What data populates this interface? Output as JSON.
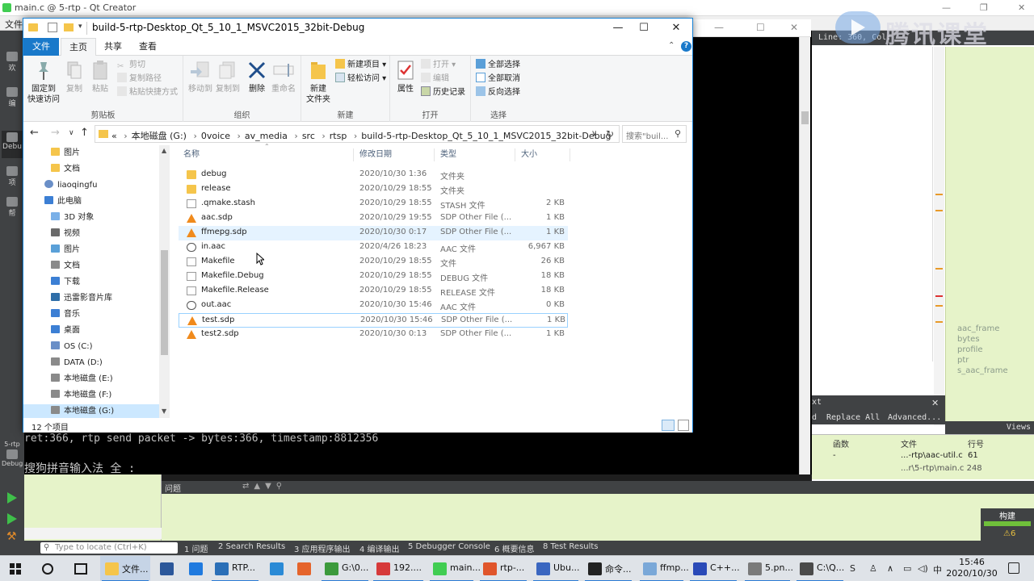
{
  "qt": {
    "title": "main.c @ 5-rtp - Qt Creator",
    "menu_file": "文件",
    "modes": [
      "欢",
      "编",
      "Debu",
      "项",
      "帮"
    ],
    "mode_run_label": "5-rtp",
    "mode_debug_label": "Debug",
    "locator_bar": "Line: 360, Col:",
    "console_line1": "ret:366, rtp send packet -> bytes:366, timestamp:8812356",
    "console_line2": "搜狗拼音输入法 全 :",
    "outline_items": [
      "aac_frame",
      "bytes",
      "profile",
      "ptr",
      "s_aac_frame"
    ],
    "find_partial": "xt",
    "find_d": "d",
    "replace_all": "Replace All",
    "advanced": "Advanced...",
    "views": "Views",
    "callstack_headers": {
      "func": "函数",
      "file": "文件",
      "line": "行号"
    },
    "callstack_row": {
      "func": "-",
      "file": "...-rtp\\aac-util.c",
      "line": "61"
    },
    "callstack_row2": "...r\\5-rtp\\main.c  248",
    "issues_header": "问题",
    "build_label": "构建",
    "warn_count": "⚠6",
    "locate_placeholder": "Type to locate (Ctrl+K)",
    "status_tabs": [
      "1 问题",
      "2 Search Results",
      "3 应用程序输出",
      "4 编译输出",
      "5 Debugger Console",
      "6 概要信息",
      "8 Test Results"
    ],
    "watermark": "腾讯课堂"
  },
  "explorer": {
    "title": "build-5-rtp-Desktop_Qt_5_10_1_MSVC2015_32bit-Debug",
    "tabs": {
      "file": "文件",
      "home": "主页",
      "share": "共享",
      "view": "查看"
    },
    "ribbon": {
      "clipboard": {
        "label": "剪贴板",
        "pin": "固定到",
        "pin2": "快速访问",
        "copy": "复制",
        "paste": "粘贴",
        "cut": "剪切",
        "copy_path": "复制路径",
        "paste_shortcut": "粘贴快捷方式"
      },
      "organize": {
        "label": "组织",
        "move_to": "移动到",
        "copy_to": "复制到",
        "delete": "删除",
        "rename": "重命名"
      },
      "new": {
        "label": "新建",
        "new_folder": "新建",
        "new_folder2": "文件夹",
        "new_item": "新建项目 ▾",
        "easy_access": "轻松访问 ▾"
      },
      "open": {
        "label": "打开",
        "properties": "属性",
        "open": "打开 ▾",
        "edit": "编辑",
        "history": "历史记录"
      },
      "select": {
        "label": "选择",
        "select_all": "全部选择",
        "select_none": "全部取消",
        "invert": "反向选择"
      }
    },
    "address": {
      "crumbs": [
        "本地磁盘 (G:)",
        "0voice",
        "av_media",
        "src",
        "rtsp",
        "build-5-rtp-Desktop_Qt_5_10_1_MSVC2015_32bit-Debug"
      ],
      "prefix": "«",
      "search_placeholder": "搜索\"buil..."
    },
    "nav": [
      {
        "label": "图片",
        "color": "#f5c54b"
      },
      {
        "label": "文档",
        "color": "#f5c54b"
      },
      {
        "label": "liaoqingfu",
        "color": "#6a8fc7"
      },
      {
        "label": "此电脑",
        "color": "#3c7fd4"
      },
      {
        "label": "3D 对象",
        "color": "#7ab0e8"
      },
      {
        "label": "视频",
        "color": "#6a6a6a"
      },
      {
        "label": "图片",
        "color": "#5aa0d8"
      },
      {
        "label": "文档",
        "color": "#8a8a8a"
      },
      {
        "label": "下载",
        "color": "#3c7fd4"
      },
      {
        "label": "迅雷影音片库",
        "color": "#2f6ea8"
      },
      {
        "label": "音乐",
        "color": "#3c7fd4"
      },
      {
        "label": "桌面",
        "color": "#3c7fd4"
      },
      {
        "label": "OS (C:)",
        "color": "#6a8fc7"
      },
      {
        "label": "DATA (D:)",
        "color": "#8a8a8a"
      },
      {
        "label": "本地磁盘 (E:)",
        "color": "#8a8a8a"
      },
      {
        "label": "本地磁盘 (F:)",
        "color": "#8a8a8a"
      },
      {
        "label": "本地磁盘 (G:)",
        "color": "#8a8a8a"
      }
    ],
    "columns": {
      "name": "名称",
      "modified": "修改日期",
      "type": "类型",
      "size": "大小"
    },
    "files": [
      {
        "name": "debug",
        "date": "2020/10/30 1:36",
        "type": "文件夹",
        "size": "",
        "icon": "folder"
      },
      {
        "name": "release",
        "date": "2020/10/29 18:55",
        "type": "文件夹",
        "size": "",
        "icon": "folder"
      },
      {
        "name": ".qmake.stash",
        "date": "2020/10/29 18:55",
        "type": "STASH 文件",
        "size": "2 KB",
        "icon": "doc"
      },
      {
        "name": "aac.sdp",
        "date": "2020/10/29 19:55",
        "type": "SDP Other File (...",
        "size": "1 KB",
        "icon": "vlc"
      },
      {
        "name": "ffmepg.sdp",
        "date": "2020/10/30 0:17",
        "type": "SDP Other File (...",
        "size": "1 KB",
        "icon": "vlc"
      },
      {
        "name": "in.aac",
        "date": "2020/4/26 18:23",
        "type": "AAC 文件",
        "size": "6,967 KB",
        "icon": "media"
      },
      {
        "name": "Makefile",
        "date": "2020/10/29 18:55",
        "type": "文件",
        "size": "26 KB",
        "icon": "doc"
      },
      {
        "name": "Makefile.Debug",
        "date": "2020/10/29 18:55",
        "type": "DEBUG 文件",
        "size": "18 KB",
        "icon": "doc"
      },
      {
        "name": "Makefile.Release",
        "date": "2020/10/29 18:55",
        "type": "RELEASE 文件",
        "size": "18 KB",
        "icon": "doc"
      },
      {
        "name": "out.aac",
        "date": "2020/10/30 15:46",
        "type": "AAC 文件",
        "size": "0 KB",
        "icon": "media"
      },
      {
        "name": "test.sdp",
        "date": "2020/10/30 15:46",
        "type": "SDP Other File (...",
        "size": "1 KB",
        "icon": "vlc"
      },
      {
        "name": "test2.sdp",
        "date": "2020/10/30 0:13",
        "type": "SDP Other File (...",
        "size": "1 KB",
        "icon": "vlc"
      }
    ],
    "status": "12 个项目"
  },
  "taskbar": {
    "apps": [
      {
        "label": "文件...",
        "color": "#f5c54b"
      },
      {
        "label": "",
        "color": "#2b579a"
      },
      {
        "label": "",
        "color": "#1f7adf"
      },
      {
        "label": "RTP...",
        "color": "#2b6fb7"
      },
      {
        "label": "",
        "color": "#2a8ad6"
      },
      {
        "label": "",
        "color": "#e5642b"
      },
      {
        "label": "G:\\0...",
        "color": "#3c9a3c"
      },
      {
        "label": "192....",
        "color": "#d63a3a"
      },
      {
        "label": "main...",
        "color": "#41cd52"
      },
      {
        "label": "rtp-...",
        "color": "#e0552b"
      },
      {
        "label": "Ubu...",
        "color": "#3a66c0"
      },
      {
        "label": "命令...",
        "color": "#222222"
      },
      {
        "label": "ffmp...",
        "color": "#7aa8d8"
      },
      {
        "label": "C++...",
        "color": "#2a4ab8"
      },
      {
        "label": "5.pn...",
        "color": "#7a7a7a"
      },
      {
        "label": "C:\\Q...",
        "color": "#4a4a4a"
      }
    ],
    "tray_ime": "中",
    "time": "15:46",
    "date": "2020/10/30"
  }
}
